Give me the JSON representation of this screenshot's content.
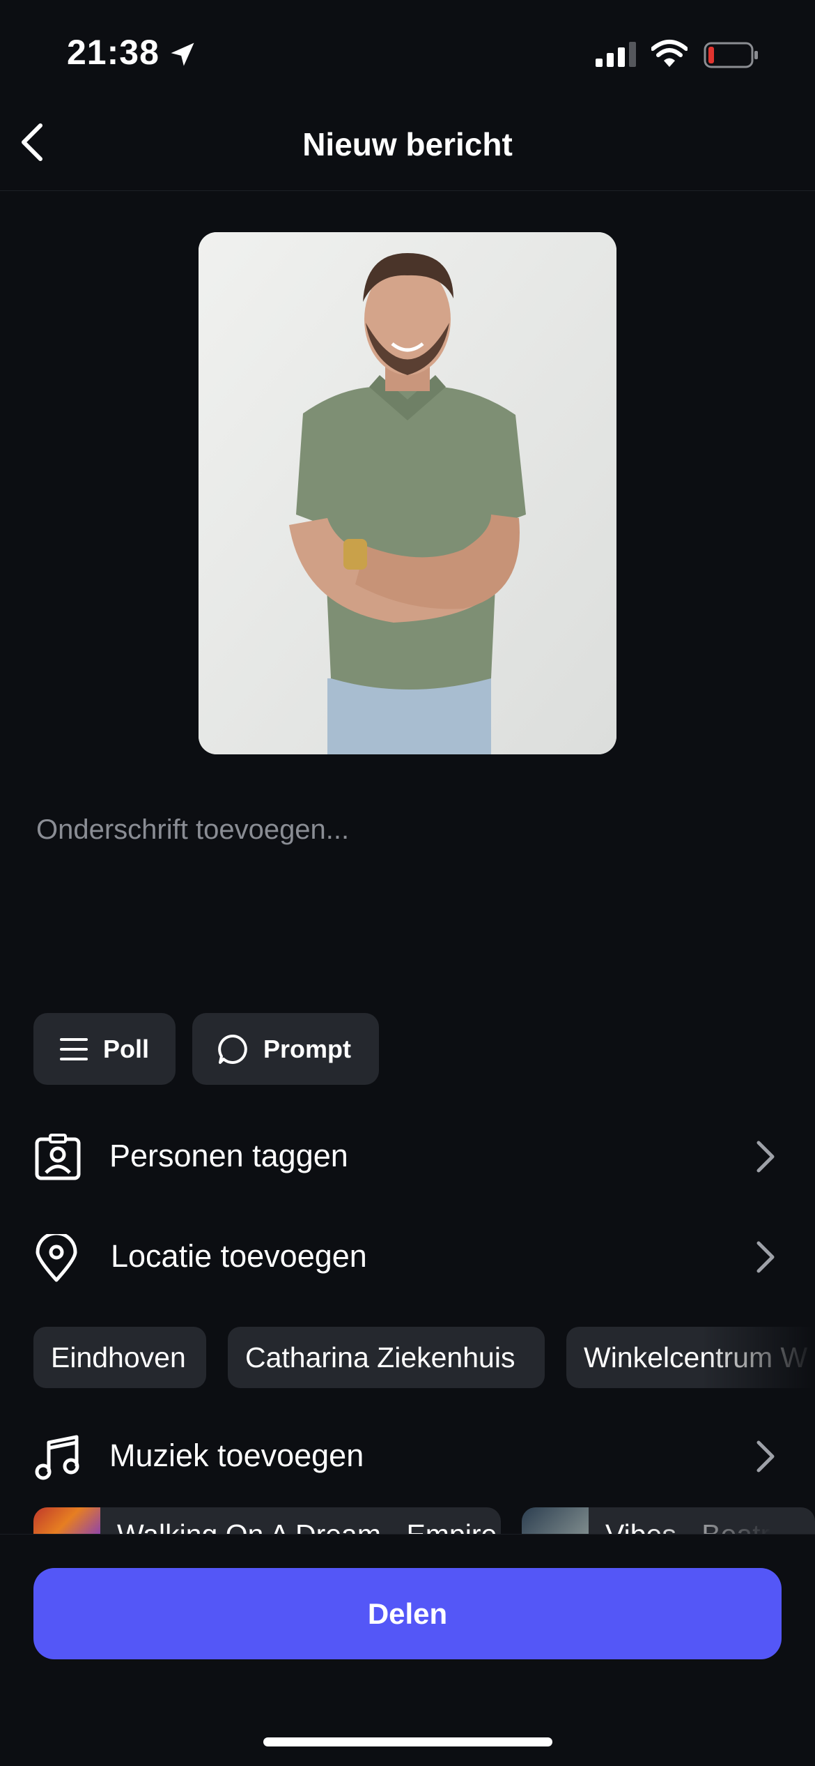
{
  "status_bar": {
    "time": "21:38"
  },
  "header": {
    "title": "Nieuw bericht"
  },
  "caption": {
    "placeholder": "Onderschrift toevoegen..."
  },
  "actions": {
    "poll_label": "Poll",
    "prompt_label": "Prompt"
  },
  "rows": {
    "tag_people": "Personen taggen",
    "add_location": "Locatie toevoegen",
    "add_music": "Muziek toevoegen"
  },
  "location_suggestions": [
    "Eindhoven",
    "Catharina Ziekenhuis",
    "Winkelcentrum W"
  ],
  "music_suggestions": [
    "Walking On A Dream - Empire",
    "Vibes - Beatrix"
  ],
  "share_button": "Delen",
  "colors": {
    "accent": "#5457f7",
    "background": "#0c0e12",
    "chip": "#25282e",
    "battery_low": "#e0342f"
  },
  "icons": [
    "location-arrow-icon",
    "signal-icon",
    "wifi-icon",
    "battery-icon",
    "back-chevron-icon",
    "menu-lines-icon",
    "chat-bubble-icon",
    "person-tag-icon",
    "map-pin-icon",
    "music-note-icon",
    "chevron-right-icon"
  ]
}
